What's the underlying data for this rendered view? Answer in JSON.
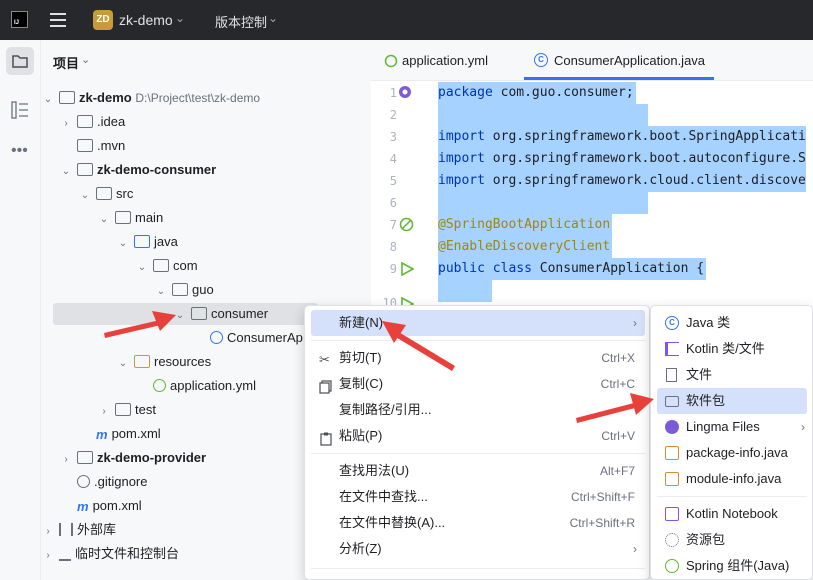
{
  "titlebar": {
    "logo": "IJ",
    "project_badge": "ZD",
    "project_name": "zk-demo",
    "vcs_menu": "版本控制"
  },
  "project_panel": {
    "title": "项目",
    "tree": [
      {
        "label": "zk-demo",
        "path": "D:\\Project\\test\\zk-demo",
        "bold": true
      },
      {
        "label": ".idea"
      },
      {
        "label": ".mvn"
      },
      {
        "label": "zk-demo-consumer",
        "bold": true
      },
      {
        "label": "src"
      },
      {
        "label": "main"
      },
      {
        "label": "java"
      },
      {
        "label": "com"
      },
      {
        "label": "guo"
      },
      {
        "label": "consumer"
      },
      {
        "label": "ConsumerAp"
      },
      {
        "label": "resources"
      },
      {
        "label": "application.yml"
      },
      {
        "label": "test"
      },
      {
        "label": "pom.xml"
      },
      {
        "label": "zk-demo-provider",
        "bold": true
      },
      {
        "label": ".gitignore"
      },
      {
        "label": "pom.xml"
      },
      {
        "label": "外部库"
      },
      {
        "label": "临时文件和控制台"
      }
    ]
  },
  "editor": {
    "tabs": [
      {
        "label": "application.yml"
      },
      {
        "label": "ConsumerApplication.java",
        "active": true
      }
    ],
    "line_numbers": [
      "1",
      "2",
      "3",
      "4",
      "5",
      "6",
      "7",
      "8",
      "9",
      "10"
    ],
    "lines": [
      {
        "kw": "package",
        "rest": " com.guo.consumer;"
      },
      {
        "kw": "",
        "rest": ""
      },
      {
        "kw": "import",
        "rest": " org.springframework.boot.SpringApplicati"
      },
      {
        "kw": "import",
        "rest": " org.springframework.boot.autoconfigure.S"
      },
      {
        "kw": "import",
        "rest": " org.springframework.cloud.client.discove"
      },
      {
        "kw": "",
        "rest": ""
      },
      {
        "ann": "@SpringBootApplication"
      },
      {
        "ann": "@EnableDiscoveryClient"
      },
      {
        "kw": "public class",
        "rest": " ConsumerApplication {"
      }
    ]
  },
  "context_menu": {
    "items": [
      {
        "label": "新建(N)",
        "shortcut": "",
        "submenu": true,
        "icon": ""
      },
      {
        "label": "剪切(T)",
        "shortcut": "Ctrl+X",
        "icon": "scissors-icon"
      },
      {
        "label": "复制(C)",
        "shortcut": "Ctrl+C",
        "icon": "copy-icon"
      },
      {
        "label": "复制路径/引用...",
        "shortcut": "",
        "icon": ""
      },
      {
        "label": "粘贴(P)",
        "shortcut": "Ctrl+V",
        "icon": "paste-icon"
      },
      {
        "label": "查找用法(U)",
        "shortcut": "Alt+F7",
        "icon": ""
      },
      {
        "label": "在文件中查找...",
        "shortcut": "Ctrl+Shift+F",
        "icon": ""
      },
      {
        "label": "在文件中替换(A)...",
        "shortcut": "Ctrl+Shift+R",
        "icon": ""
      },
      {
        "label": "分析(Z)",
        "shortcut": "",
        "submenu": true,
        "icon": ""
      }
    ]
  },
  "new_submenu": {
    "items": [
      {
        "label": "Java 类",
        "icon": "java-class-icon"
      },
      {
        "label": "Kotlin 类/文件",
        "icon": "kotlin-icon"
      },
      {
        "label": "文件",
        "icon": "file-icon"
      },
      {
        "label": "软件包",
        "icon": "package-icon",
        "highlighted": true
      },
      {
        "label": "Lingma Files",
        "icon": "lingma-icon",
        "submenu": true
      },
      {
        "label": "package-info.java",
        "icon": "java-file-icon"
      },
      {
        "label": "module-info.java",
        "icon": "java-file-icon"
      },
      {
        "label": "Kotlin Notebook",
        "icon": "kotlin-notebook-icon"
      },
      {
        "label": "资源包",
        "icon": "gear-icon"
      },
      {
        "label": "Spring 组件(Java)",
        "icon": "spring-icon"
      }
    ]
  },
  "colors": {
    "accent": "#3574f0",
    "selection": "#a6d2ff",
    "annotation_arrow": "#e8403a"
  }
}
